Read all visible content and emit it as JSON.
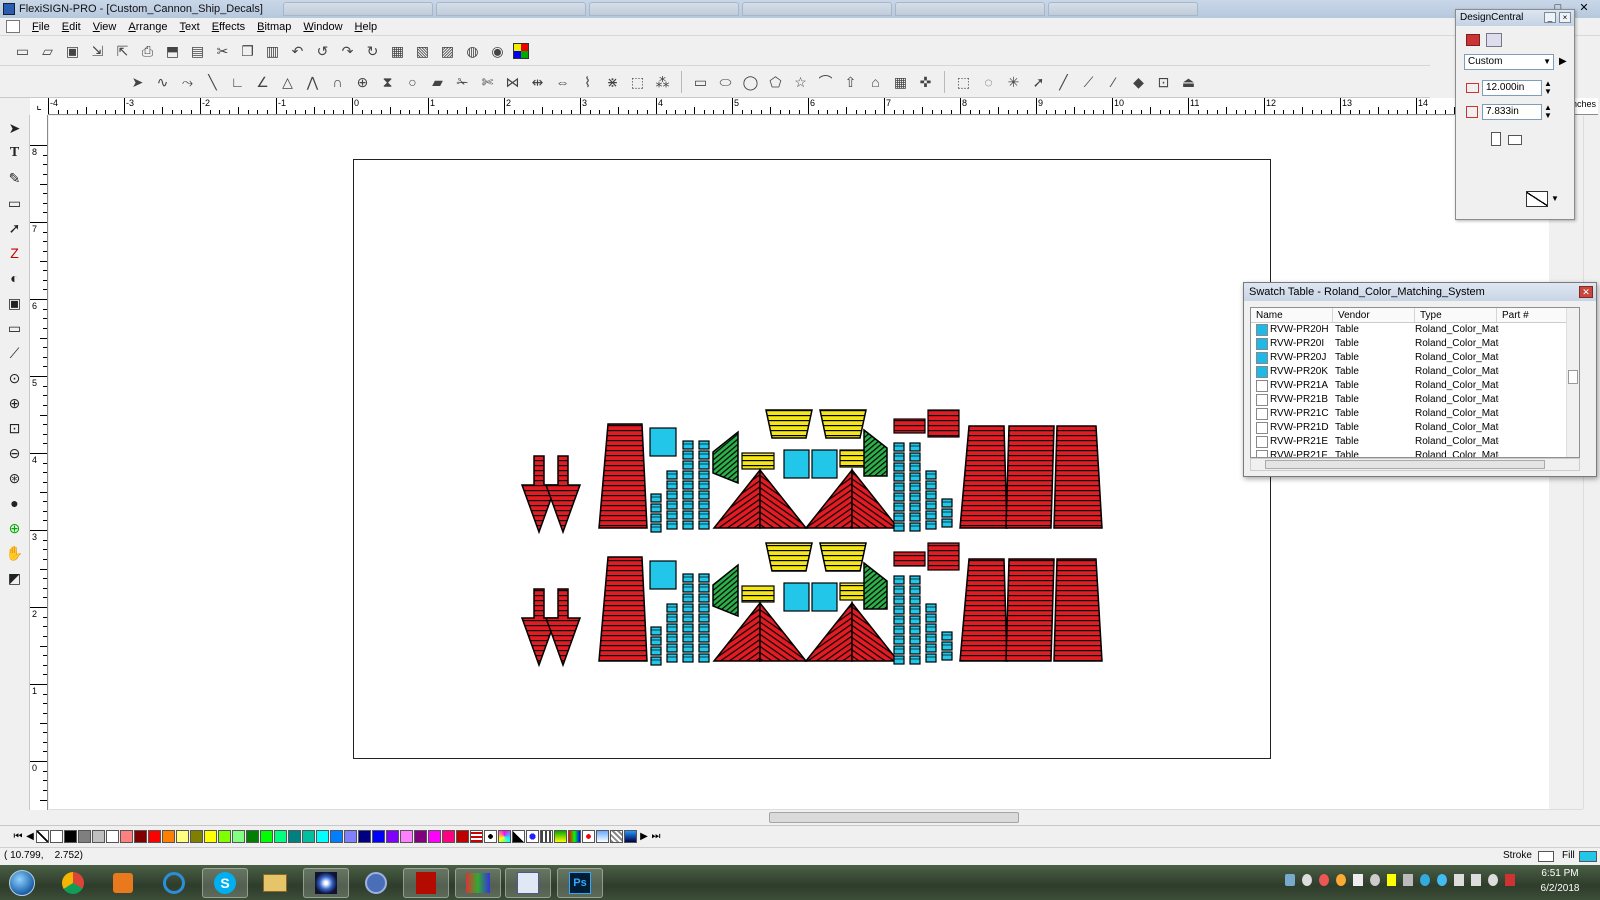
{
  "window": {
    "title": "FlexiSIGN-PRO - [Custom_Cannon_Ship_Decals]",
    "controls": [
      "_",
      "□",
      "✕"
    ]
  },
  "menu": [
    "File",
    "Edit",
    "View",
    "Arrange",
    "Text",
    "Effects",
    "Bitmap",
    "Window",
    "Help"
  ],
  "toolbar1_icons": [
    "new-icon",
    "open-icon",
    "save-icon",
    "import-icon",
    "export-icon",
    "print-icon",
    "send-icon",
    "cut-icon",
    "copy-icon",
    "paste-icon",
    "undo-icon",
    "redo-icon",
    "align-icon",
    "zoom-icon",
    "color-icon"
  ],
  "toolbar2_icons": [
    "node-edit-icon",
    "curve-icon",
    "knife-icon",
    "line-icon",
    "corner-icon",
    "shape-icon",
    "rectangle-icon",
    "ellipse-icon",
    "circle-icon",
    "polygon-icon",
    "star-icon",
    "arc-icon",
    "arrow-icon",
    "house-icon",
    "select-icon",
    "lasso-icon",
    "magic-wand-icon",
    "pen-icon",
    "brush-icon",
    "fill-icon",
    "crop-icon",
    "stamp-icon"
  ],
  "ruler": {
    "unit_label": "inches",
    "h_labels": [
      "-4",
      "-3",
      "-2",
      "-1",
      "0",
      "1",
      "2",
      "3",
      "4",
      "5",
      "6",
      "7",
      "8",
      "9",
      "10",
      "11",
      "12",
      "13",
      "14"
    ],
    "v_labels": [
      "8",
      "7",
      "6",
      "5",
      "4",
      "3",
      "2",
      "1",
      "0"
    ]
  },
  "designcentral": {
    "title": "DesignCentral",
    "preset": "Custom",
    "width": "12.000in",
    "height": "7.833in"
  },
  "swatch_table": {
    "title": "Swatch Table - Roland_Color_Matching_System",
    "columns": [
      "Name",
      "Vendor",
      "Type",
      "Part #"
    ],
    "rows": [
      {
        "name": "RVW-PR20H",
        "vendor": "Table",
        "type": "Roland_Color_Matc",
        "color": "#1fb9e8"
      },
      {
        "name": "RVW-PR20I",
        "vendor": "Table",
        "type": "Roland_Color_Matc",
        "color": "#1fb9e8"
      },
      {
        "name": "RVW-PR20J",
        "vendor": "Table",
        "type": "Roland_Color_Matc",
        "color": "#1fb9e8"
      },
      {
        "name": "RVW-PR20K",
        "vendor": "Table",
        "type": "Roland_Color_Matc",
        "color": "#1fb9e8"
      },
      {
        "name": "RVW-PR21A",
        "vendor": "Table",
        "type": "Roland_Color_Matc",
        "color": "#ffffff"
      },
      {
        "name": "RVW-PR21B",
        "vendor": "Table",
        "type": "Roland_Color_Matc",
        "color": "#ffffff"
      },
      {
        "name": "RVW-PR21C",
        "vendor": "Table",
        "type": "Roland_Color_Matc",
        "color": "#ffffff"
      },
      {
        "name": "RVW-PR21D",
        "vendor": "Table",
        "type": "Roland_Color_Matc",
        "color": "#ffffff"
      },
      {
        "name": "RVW-PR21E",
        "vendor": "Table",
        "type": "Roland_Color_Matc",
        "color": "#ffffff"
      },
      {
        "name": "RVW-PR21F",
        "vendor": "Table",
        "type": "Roland_Color_Matc",
        "color": "#ffffff"
      }
    ]
  },
  "palette_colors": [
    "#ffffff",
    "#000000",
    "#7f7f7f",
    "#c0c0c0",
    "#ffffff",
    "#ff8080",
    "#800000",
    "#ff0000",
    "#ff8000",
    "#ffff80",
    "#808000",
    "#ffff00",
    "#80ff00",
    "#80ff80",
    "#008000",
    "#00ff00",
    "#00ff80",
    "#008080",
    "#00c0a0",
    "#00ffff",
    "#0080ff",
    "#8080ff",
    "#000080",
    "#0000ff",
    "#8000ff",
    "#ff80ff",
    "#800080",
    "#ff00ff",
    "#ff0080",
    "#c00000"
  ],
  "status": {
    "coords": "( 10.799,    2.752)",
    "stroke_label": "Stroke",
    "fill_label": "Fill"
  },
  "clock": {
    "time": "6:51 PM",
    "date": "6/2/2018"
  },
  "taskbar_apps": [
    "start-orb-icon",
    "chrome-icon",
    "media-player-icon",
    "ccleaner-icon",
    "skype-icon",
    "explorer-icon",
    "capture-icon",
    "photo-viewer-icon",
    "acrobat-icon",
    "flexi-production-icon",
    "flexisign-icon",
    "photoshop-icon"
  ],
  "accents": {
    "decal_red": "#e31b23",
    "decal_cyan": "#22c6e8",
    "decal_yellow": "#f5e61a",
    "decal_green": "#2db04a"
  }
}
